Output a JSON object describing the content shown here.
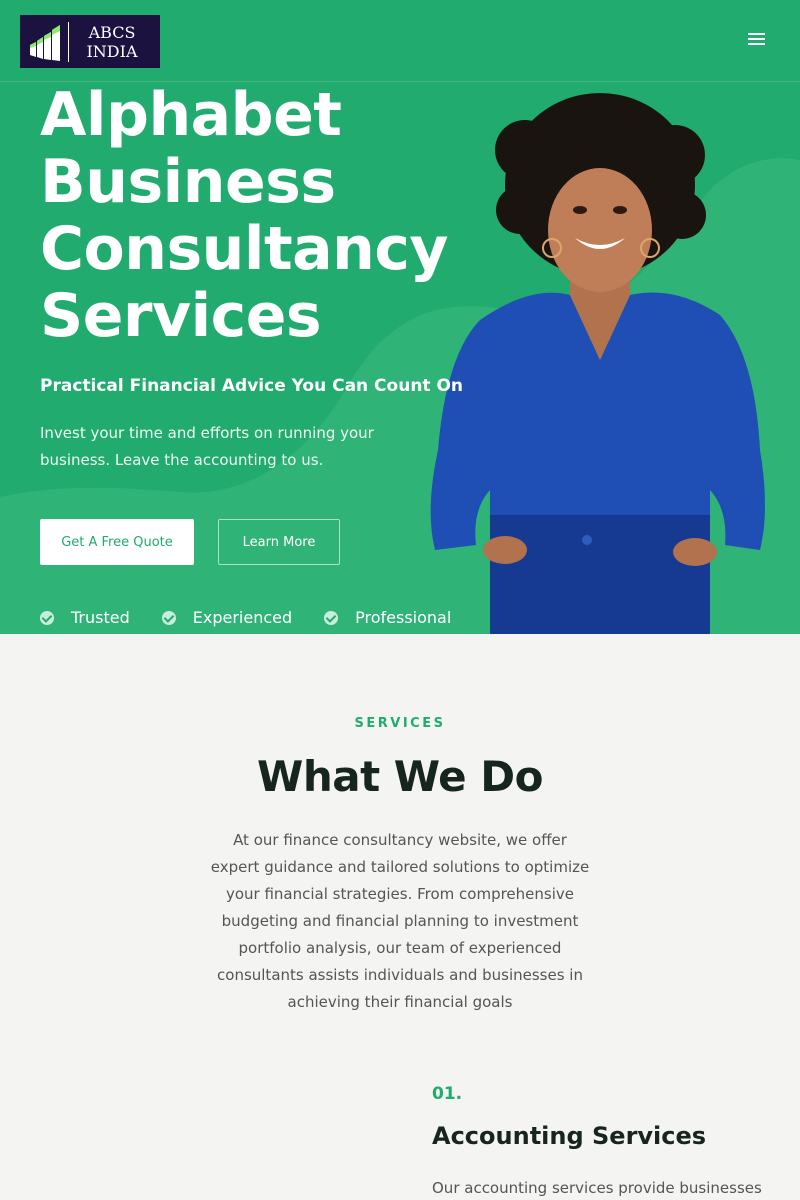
{
  "brand": {
    "logo_line1": "ABCS",
    "logo_line2": "INDIA",
    "primary_color": "#21ab6e",
    "logo_bg": "#1b1240"
  },
  "header": {
    "menu_icon": "hamburger-menu-icon"
  },
  "hero": {
    "title_lines": [
      "Alphabet",
      "Business",
      "Consultancy",
      "Services"
    ],
    "subtitle": "Practical Financial Advice You Can Count On",
    "description": "Invest your time and efforts on running your business. Leave the accounting to us.",
    "primary_button": "Get A Free Quote",
    "secondary_button": "Learn More",
    "features": [
      "Trusted",
      "Experienced",
      "Professional"
    ]
  },
  "services": {
    "eyebrow": "SERVICES",
    "title": "What We Do",
    "description": "At our finance consultancy website, we offer expert guidance and tailored solutions to optimize your financial strategies. From comprehensive budgeting and financial planning to investment portfolio analysis, our team of experienced consultants assists individuals and businesses in achieving their financial goals",
    "items": [
      {
        "number": "01.",
        "title": "Accounting Services",
        "description": "Our accounting services provide businesses"
      }
    ]
  }
}
